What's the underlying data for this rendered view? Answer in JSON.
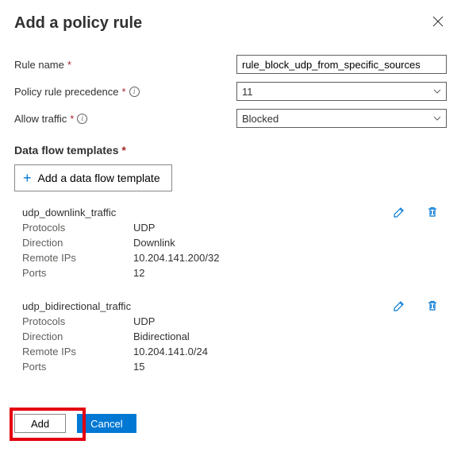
{
  "header": {
    "title": "Add a policy rule"
  },
  "form": {
    "rule_name_label": "Rule name",
    "rule_name_value": "rule_block_udp_from_specific_sources",
    "precedence_label": "Policy rule precedence",
    "precedence_value": "11",
    "allow_traffic_label": "Allow traffic",
    "allow_traffic_value": "Blocked"
  },
  "templates_section": {
    "title": "Data flow templates",
    "add_button": "Add a data flow template",
    "labels": {
      "protocols": "Protocols",
      "direction": "Direction",
      "remote_ips": "Remote IPs",
      "ports": "Ports"
    },
    "items": [
      {
        "name": "udp_downlink_traffic",
        "protocols": "UDP",
        "direction": "Downlink",
        "remote_ips": "10.204.141.200/32",
        "ports": "12"
      },
      {
        "name": "udp_bidirectional_traffic",
        "protocols": "UDP",
        "direction": "Bidirectional",
        "remote_ips": "10.204.141.0/24",
        "ports": "15"
      }
    ]
  },
  "footer": {
    "add": "Add",
    "cancel": "Cancel"
  }
}
